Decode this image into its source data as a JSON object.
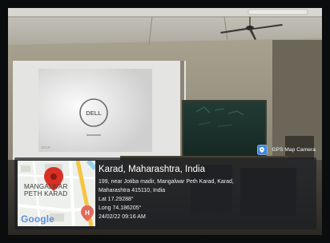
{
  "badge": {
    "label": "GPS Map Camera",
    "icon": "gps-camera-icon"
  },
  "location": {
    "title": "Karad, Maharashtra, India",
    "address_line1": "199, near Jotiba madir, Mangalwar Peth Karad, Karad,",
    "address_line2": "Maharashtra 415110, India",
    "lat": "Lat 17.29288°",
    "long": "Long 74.186205°",
    "datetime": "24/02/22 09:16 AM"
  },
  "map": {
    "label_line1": "MANGALWAR",
    "label_line2": "PETH KARAD",
    "logo": "Google",
    "pin_color": "#d93025",
    "hospital_icon": "hospital-icon"
  },
  "scene": {
    "screen_brand": "DELL",
    "projector_sticker": "DICP"
  }
}
